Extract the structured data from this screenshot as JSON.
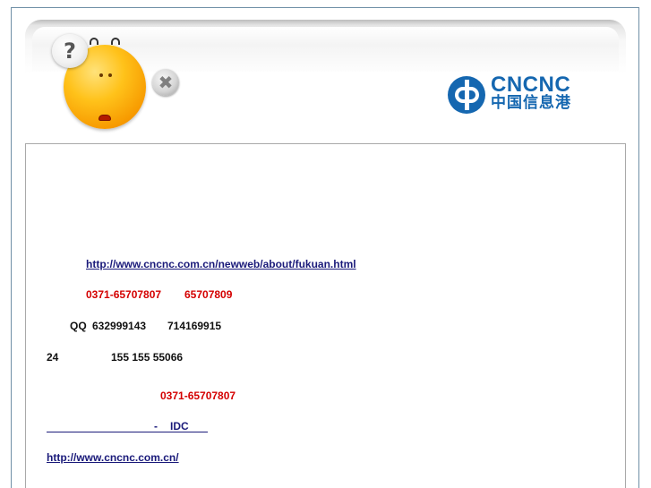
{
  "header": {
    "question_glyph": "?",
    "close_glyph": "✖",
    "logo": {
      "name": "CNCNC",
      "subtitle": "中国信息港",
      "brand_color": "#1567b0"
    }
  },
  "content": {
    "payment_link": "http://www.cncnc.com.cn/newweb/about/fukuan.html",
    "phones": {
      "primary": "0371-65707807",
      "secondary": "65707809"
    },
    "qq": {
      "label": "QQ",
      "number1": "632999143",
      "number2": "714169915"
    },
    "support": {
      "hours": "24",
      "mobile": "155 155 55066"
    },
    "phone_repeat": "0371-65707807",
    "idc_link": {
      "separator": "-",
      "label": "IDC"
    },
    "home_link": "http://www.cncnc.com.cn/"
  },
  "colors": {
    "link": "#1a1a7a",
    "accent_red": "#d40000",
    "frame_border": "#6f8fa6"
  }
}
